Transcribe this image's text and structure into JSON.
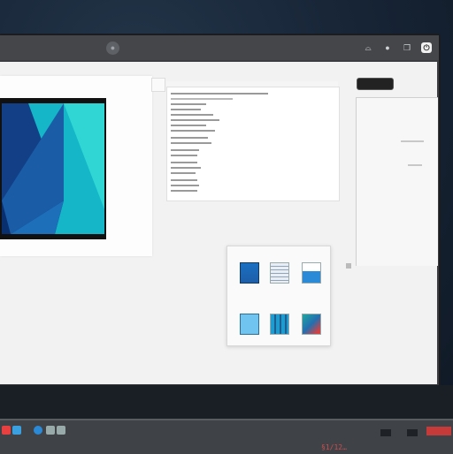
{
  "window": {
    "title_logo": "●",
    "subtitle": "···",
    "controls": [
      {
        "name": "refresh",
        "glyph": "⌓"
      },
      {
        "name": "settings",
        "glyph": "●"
      },
      {
        "name": "restore",
        "glyph": "❒"
      },
      {
        "name": "power",
        "glyph": "⏻"
      }
    ]
  },
  "preview": {
    "colors": {
      "dark": "#0a2f6e",
      "mid": "#1c6fb8",
      "teal": "#14b6c8",
      "cyan": "#2fd6d4"
    }
  },
  "picker": {
    "tiles": [
      "layout-blue-icon",
      "layout-table-icon",
      "layout-header-icon",
      "layout-solid-icon",
      "layout-grid-icon",
      "layout-photo-icon"
    ]
  },
  "dock": {
    "icons": [
      {
        "name": "app-1-icon",
        "color": "#ef6a3a"
      },
      {
        "name": "app-2-icon",
        "color": "#cf3e3e"
      },
      {
        "name": "app-3-icon",
        "color": "#2bc6c6"
      },
      {
        "name": "app-4-icon",
        "color": "#38c76a"
      },
      {
        "name": "app-5-icon",
        "color": "#f08a3a"
      },
      {
        "name": "app-6-icon",
        "color": "#b82f2f"
      },
      {
        "name": "app-7-icon",
        "color": "#d0b070"
      },
      {
        "name": "app-8-icon",
        "color": "#e2c240"
      },
      {
        "name": "app-9-icon",
        "color": "#8a7ad8"
      },
      {
        "name": "app-10-icon",
        "color": "#a8b4c4"
      },
      {
        "name": "app-11-icon",
        "color": "#6a8ad8"
      }
    ]
  },
  "taskbar": {
    "clock_text": "§1/12…"
  }
}
